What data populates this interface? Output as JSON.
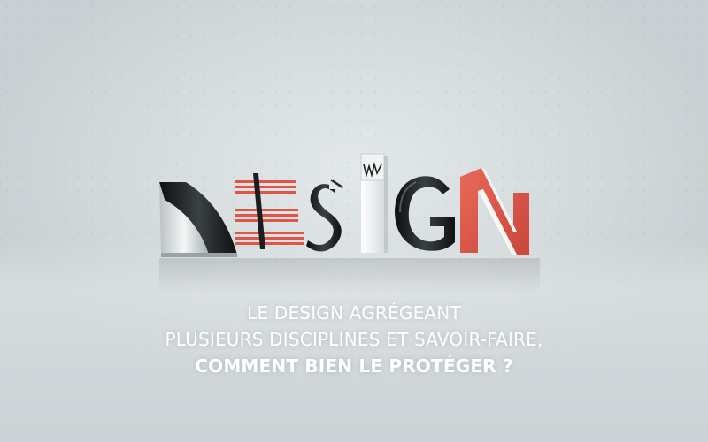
{
  "caption": {
    "line1": "LE DESIGN AGRÉGEANT",
    "line2": "PLUSIEURS DISCIPLINES ET SAVOIR-FAIRE,",
    "line3": "COMMENT BIEN LE PROTÉGER ?"
  },
  "colors": {
    "red": "#e05545",
    "black": "#1f2326",
    "white": "#f4f5f5",
    "caption_text": "#ffffff"
  }
}
